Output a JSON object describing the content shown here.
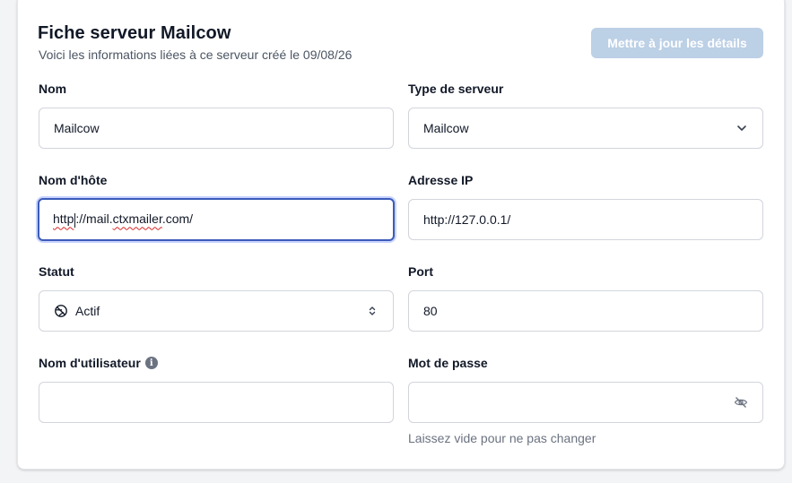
{
  "header": {
    "title": "Fiche serveur Mailcow",
    "subtitle": "Voici les informations liées à ce serveur créé le 09/08/26",
    "update_button": "Mettre à jour les détails"
  },
  "fields": {
    "name": {
      "label": "Nom",
      "value": "Mailcow"
    },
    "server_type": {
      "label": "Type de serveur",
      "value": "Mailcow"
    },
    "hostname": {
      "label": "Nom d'hôte",
      "value_part1": "http",
      "value_part2": "//mail.",
      "value_part3": "ctxmailer",
      "value_part4": ".com/",
      "colon": ":"
    },
    "ip_address": {
      "label": "Adresse IP",
      "value": "http://127.0.0.1/"
    },
    "status": {
      "label": "Statut",
      "value": "Actif"
    },
    "port": {
      "label": "Port",
      "value": "80"
    },
    "username": {
      "label": "Nom d'utilisateur",
      "value": ""
    },
    "password": {
      "label": "Mot de passe",
      "value": "",
      "hint": "Laissez vide pour ne pas changer"
    }
  },
  "icons": {
    "info": "info-icon",
    "chevron": "chevron-down-icon",
    "updown": "chevron-up-down-icon",
    "status": "globe-off-icon",
    "eye": "eye-slash-icon"
  },
  "colors": {
    "primary_disabled": "#bcd0e6",
    "focus_ring": "#3b5bb8"
  }
}
